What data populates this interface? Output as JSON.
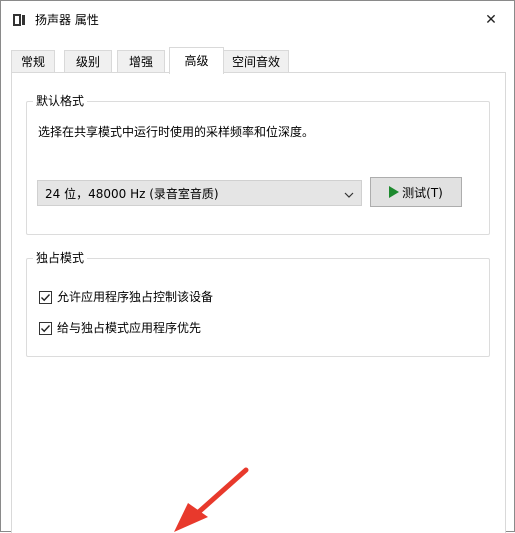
{
  "window": {
    "title": "扬声器 属性",
    "title_icon": "speaker-icon",
    "close_icon": "close-icon",
    "close_glyph": "✕"
  },
  "tabs": [
    {
      "label": "常规",
      "active": false
    },
    {
      "label": "级别",
      "active": false
    },
    {
      "label": "增强",
      "active": false
    },
    {
      "label": "高级",
      "active": true
    },
    {
      "label": "空间音效",
      "active": false
    }
  ],
  "default_format": {
    "legend": "默认格式",
    "description": "选择在共享模式中运行时使用的采样频率和位深度。",
    "selected_value": "24 位，48000 Hz (录音室音质)",
    "test_button_label": "测试(T)",
    "test_icon": "play-icon"
  },
  "exclusive_mode": {
    "legend": "独占模式",
    "options": [
      {
        "label": "允许应用程序独占控制该设备",
        "checked": true
      },
      {
        "label": "给与独占模式应用程序优先",
        "checked": true
      }
    ]
  },
  "colors": {
    "accent_arrow": "#e8392c",
    "play_green": "#1e8a2f",
    "select_bg": "#e5e5e5"
  }
}
